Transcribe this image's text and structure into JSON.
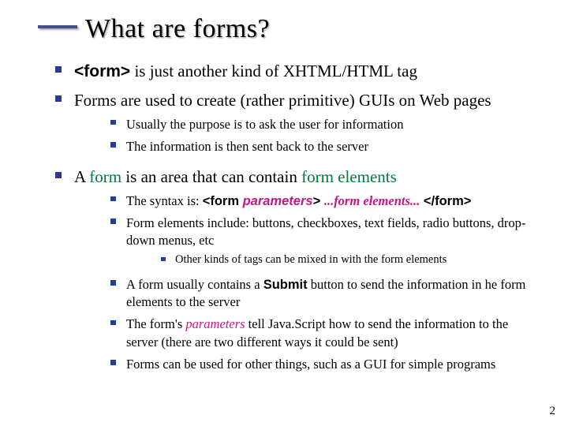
{
  "title": "What are forms?",
  "b1a": "<form>",
  "b1b": " is just another kind of XHTML/HTML tag",
  "b2": "Forms are used to create (rather primitive) GUIs on Web pages",
  "b2_1": "Usually the purpose is to ask the user for information",
  "b2_2": "The information is then sent back to the server",
  "b3a": "A ",
  "b3b": "form",
  "b3c": " is an area that can contain ",
  "b3d": "form elements",
  "b3_1a": "The syntax is: ",
  "b3_1b": "<form ",
  "b3_1c": "parameters",
  "b3_1d": "> ",
  "b3_1e": "...form elements...",
  "b3_1f": " </form>",
  "b3_2": "Form elements include: buttons, checkboxes, text fields, radio buttons, drop-down menus, etc",
  "b3_2_1": "Other kinds of tags can be mixed in with the form elements",
  "b3_3a": "A form usually contains a ",
  "b3_3b": "Submit",
  "b3_3c": " button to send the information in he form elements to the server",
  "b3_4a": "The form's ",
  "b3_4b": "parameters",
  "b3_4c": " tell Java.Script how to send the information to the server (there are two different ways it could be sent)",
  "b3_5": "Forms can be used for other things, such as a GUI for simple programs",
  "page": "2"
}
